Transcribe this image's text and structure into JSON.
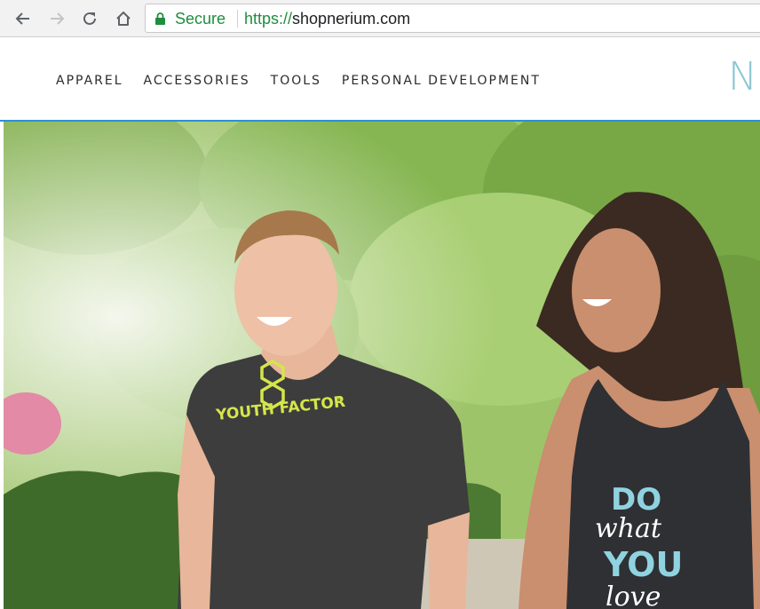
{
  "browser": {
    "secure_label": "Secure",
    "url_scheme": "https://",
    "url_host": "shopnerium.com"
  },
  "site": {
    "logo_text": "Ne",
    "nav": [
      {
        "label": "APPAREL"
      },
      {
        "label": "ACCESSORIES"
      },
      {
        "label": "TOOLS"
      },
      {
        "label": "PERSONAL DEVELOPMENT"
      }
    ]
  },
  "hero": {
    "shirt_left_text": "YOUTH FACTOR",
    "shirt_left_tm": "™",
    "shirt_right_lines": [
      "DO",
      "what",
      "YOU",
      "love"
    ]
  },
  "colors": {
    "secure_green": "#1e8e3e",
    "header_accent": "#2f8fd8",
    "logo": "#8cc7d3",
    "shirt_print_lime": "#d4e64a",
    "shirt_print_teal": "#8fd3e0"
  }
}
